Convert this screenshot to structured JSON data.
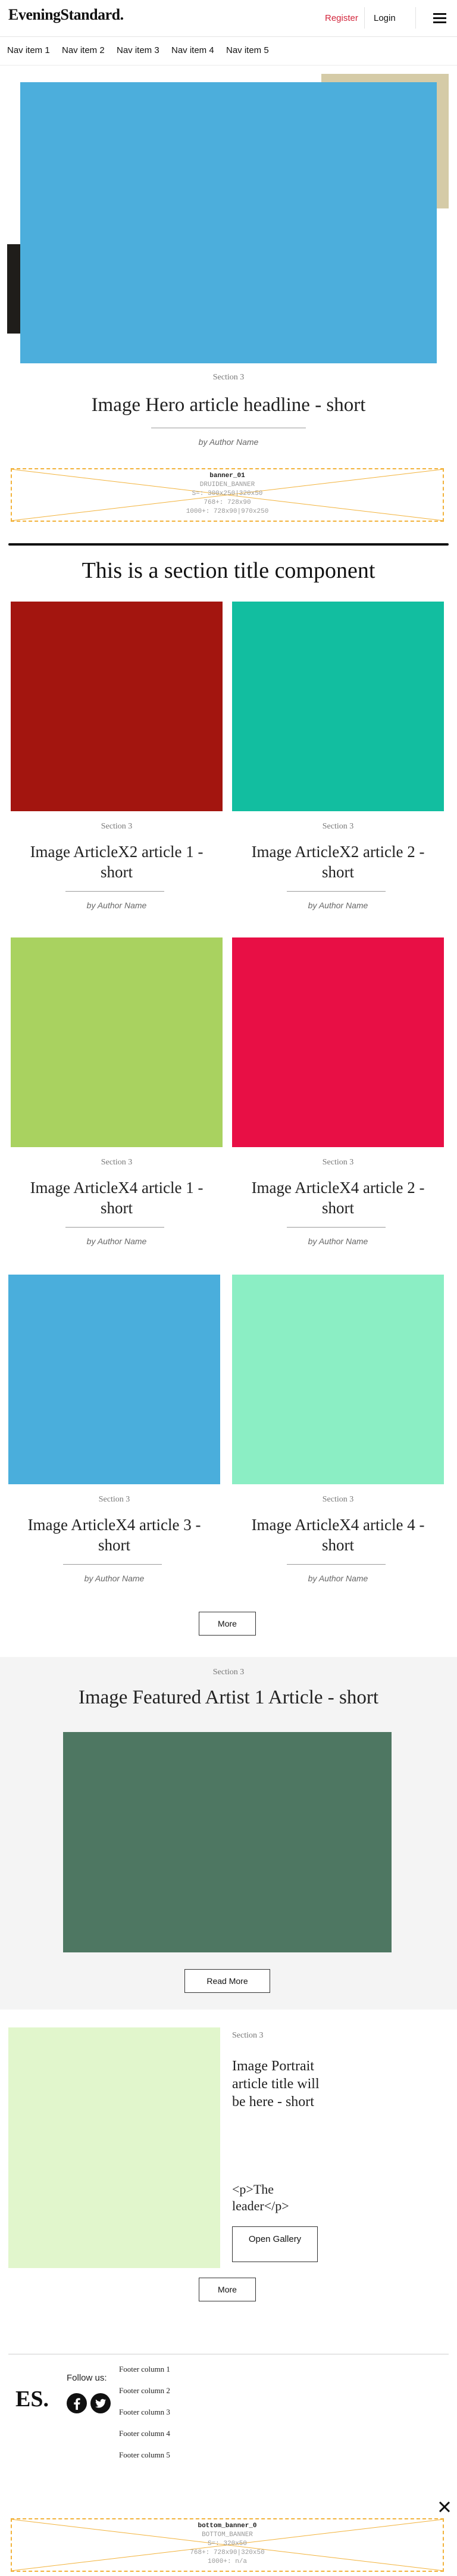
{
  "header": {
    "logo": "EveningStandard.",
    "register": "Register",
    "login": "Login",
    "menu_icon": "hamburger-menu-icon"
  },
  "nav": {
    "items": [
      "Nav item 1",
      "Nav item 2",
      "Nav item 3",
      "Nav item 4",
      "Nav item 5"
    ]
  },
  "hero": {
    "section": "Section 3",
    "headline": "Image Hero article headline - short",
    "author": "by Author Name",
    "image_color": "#4caedc"
  },
  "banner_top": {
    "name": "banner_01",
    "lines": [
      "DRUIDEN_BANNER",
      "S=: 300x250|320x50",
      "768+: 728x90",
      "1000+: 728x90|970x250"
    ]
  },
  "section_title": "This is a section title component",
  "articles": [
    {
      "section": "Section 3",
      "title": "Image ArticleX2 article 1 - short",
      "author": "by Author Name",
      "color": "#a3150f"
    },
    {
      "section": "Section 3",
      "title": "Image ArticleX2 article 2 - short",
      "author": "by Author Name",
      "color": "#12bea0"
    },
    {
      "section": "Section 3",
      "title": "Image ArticleX4 article 1 - short",
      "author": "by Author Name",
      "color": "#a9d260"
    },
    {
      "section": "Section 3",
      "title": "Image ArticleX4 article 2 - short",
      "author": "by Author Name",
      "color": "#e80f45"
    },
    {
      "section": "Section 3",
      "title": "Image ArticleX4 article 3 - short",
      "author": "by Author Name",
      "color": "#4aaedc"
    },
    {
      "section": "Section 3",
      "title": "Image ArticleX4 article 4 - short",
      "author": "by Author Name",
      "color": "#8beec4"
    }
  ],
  "more_button": "More",
  "featured": {
    "section": "Section 3",
    "title": "Image Featured Artist 1 Article - short",
    "image_color": "#4e7762",
    "read_more": "Read More"
  },
  "portrait": {
    "section": "Section 3",
    "title": "Image Portrait article title will be here - short",
    "leader": "<p>The leader</p>",
    "open_gallery": "Open Gallery",
    "image_color": "#e1f6cc"
  },
  "more_button_2": "More",
  "footer": {
    "logo": "ES.",
    "follow": "Follow us:",
    "social_icons": [
      "facebook-icon",
      "twitter-icon"
    ],
    "columns": [
      "Footer column 1",
      "Footer column 2",
      "Footer column 3",
      "Footer column 4",
      "Footer column 5"
    ]
  },
  "banner_bottom": {
    "name": "bottom_banner_0",
    "lines": [
      "BOTTOM_BANNER",
      "S=: 320x50",
      "768+: 728x90|320x50",
      "1000+: n/a"
    ],
    "close_icon": "close-icon"
  }
}
